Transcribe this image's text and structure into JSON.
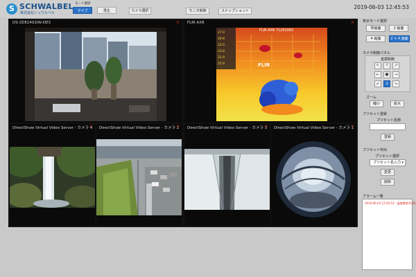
{
  "app": {
    "brand": "SCHWALBEL",
    "brand_sub": "株式会社シュワルベル",
    "logo_letter": "S",
    "datetime": "2019-06-03 12:45:53"
  },
  "mode": {
    "label": "モード選択",
    "live_label": "ライブ",
    "playback_label": "再生"
  },
  "toolbar": {
    "camera_select": "カメラ選択",
    "monitor_switch": "モニタ制御",
    "snapshot": "スナップショット"
  },
  "tiles": [
    {
      "label": "DS-2DE2402IW-DE3",
      "close": "×"
    },
    {
      "label": "FLIR AX8",
      "close": "×"
    },
    {
      "label": "DirectShow Virtual Video Server - カメラ 4",
      "close": "×"
    },
    {
      "label": "DirectShow Virtual Video Server - カメラ 2",
      "close": "×"
    },
    {
      "label": "DirectShow Virtual Video Server - カメラ 3",
      "close": "×"
    },
    {
      "label": "DirectShow Virtual Video Server - カメラ 1",
      "close": "×"
    }
  ],
  "thermal": {
    "header": "FLIR AX8 71201092",
    "brand": "FLIR",
    "readouts": [
      "27.0",
      "29.8",
      "22.0",
      "23.8",
      "21.9",
      "25.8"
    ]
  },
  "panel": {
    "display_mode_title": "表示モード選択",
    "single": "単画面",
    "dual": "2 画面",
    "quad": "4 画面",
    "six": "2 × 4 画面",
    "camera_panel_title": "カメラ制御パネル",
    "direction_title": "首振制御",
    "direction_arrows": [
      "↖",
      "↑",
      "↗",
      "←",
      "●",
      "→",
      "↙",
      "↓",
      "↘"
    ],
    "zoom_title": "ズーム",
    "zoom_out": "縮小",
    "zoom_in": "拡大",
    "preset_register_title": "プリセット登録",
    "preset_name_label": "プリセット名称",
    "register_button": "登録",
    "preset_call_title": "プリセット呼出",
    "preset_select_label": "プリセット選択",
    "preset_placeholder": "プリセット名入力",
    "change_button": "変更",
    "delete_button": "削除",
    "alarm_title": "アラーム一覧",
    "alarm_entry": "2019-06-03 12:45:53 : 温度異常(FLIR)"
  },
  "colors": {
    "accent": "#2b73c9",
    "brand": "#1b4f8a",
    "alarm": "#dd2222"
  }
}
